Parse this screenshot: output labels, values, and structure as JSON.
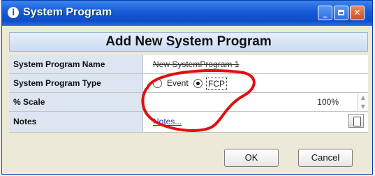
{
  "window": {
    "title": "System Program"
  },
  "dialog": {
    "heading": "Add New System Program",
    "fields": [
      {
        "label": "System Program Name",
        "value": "New SystemProgram 1"
      },
      {
        "label": "System Program Type",
        "options": [
          "Event",
          "FCP"
        ],
        "selected": "FCP"
      },
      {
        "label": "% Scale",
        "value": "100%"
      },
      {
        "label": "Notes",
        "link_text": "Notes..."
      }
    ],
    "buttons": {
      "ok": "OK",
      "cancel": "Cancel"
    }
  },
  "annotation_color": "#e01010",
  "icons": {
    "app": "info-icon",
    "minimize": "minimize-icon",
    "maximize": "maximize-icon",
    "close": "close-icon",
    "notes": "notes-icon"
  }
}
